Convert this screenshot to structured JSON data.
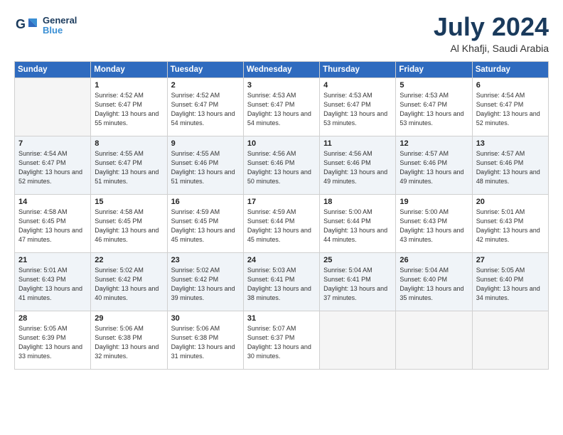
{
  "header": {
    "logo_line1": "General",
    "logo_line2": "Blue",
    "month": "July 2024",
    "location": "Al Khafji, Saudi Arabia"
  },
  "weekdays": [
    "Sunday",
    "Monday",
    "Tuesday",
    "Wednesday",
    "Thursday",
    "Friday",
    "Saturday"
  ],
  "weeks": [
    [
      {
        "day": "",
        "empty": true
      },
      {
        "day": "1",
        "sunrise": "4:52 AM",
        "sunset": "6:47 PM",
        "daylight": "13 hours and 55 minutes."
      },
      {
        "day": "2",
        "sunrise": "4:52 AM",
        "sunset": "6:47 PM",
        "daylight": "13 hours and 54 minutes."
      },
      {
        "day": "3",
        "sunrise": "4:53 AM",
        "sunset": "6:47 PM",
        "daylight": "13 hours and 54 minutes."
      },
      {
        "day": "4",
        "sunrise": "4:53 AM",
        "sunset": "6:47 PM",
        "daylight": "13 hours and 53 minutes."
      },
      {
        "day": "5",
        "sunrise": "4:53 AM",
        "sunset": "6:47 PM",
        "daylight": "13 hours and 53 minutes."
      },
      {
        "day": "6",
        "sunrise": "4:54 AM",
        "sunset": "6:47 PM",
        "daylight": "13 hours and 52 minutes."
      }
    ],
    [
      {
        "day": "7",
        "sunrise": "4:54 AM",
        "sunset": "6:47 PM",
        "daylight": "13 hours and 52 minutes."
      },
      {
        "day": "8",
        "sunrise": "4:55 AM",
        "sunset": "6:47 PM",
        "daylight": "13 hours and 51 minutes."
      },
      {
        "day": "9",
        "sunrise": "4:55 AM",
        "sunset": "6:46 PM",
        "daylight": "13 hours and 51 minutes."
      },
      {
        "day": "10",
        "sunrise": "4:56 AM",
        "sunset": "6:46 PM",
        "daylight": "13 hours and 50 minutes."
      },
      {
        "day": "11",
        "sunrise": "4:56 AM",
        "sunset": "6:46 PM",
        "daylight": "13 hours and 49 minutes."
      },
      {
        "day": "12",
        "sunrise": "4:57 AM",
        "sunset": "6:46 PM",
        "daylight": "13 hours and 49 minutes."
      },
      {
        "day": "13",
        "sunrise": "4:57 AM",
        "sunset": "6:46 PM",
        "daylight": "13 hours and 48 minutes."
      }
    ],
    [
      {
        "day": "14",
        "sunrise": "4:58 AM",
        "sunset": "6:45 PM",
        "daylight": "13 hours and 47 minutes."
      },
      {
        "day": "15",
        "sunrise": "4:58 AM",
        "sunset": "6:45 PM",
        "daylight": "13 hours and 46 minutes."
      },
      {
        "day": "16",
        "sunrise": "4:59 AM",
        "sunset": "6:45 PM",
        "daylight": "13 hours and 45 minutes."
      },
      {
        "day": "17",
        "sunrise": "4:59 AM",
        "sunset": "6:44 PM",
        "daylight": "13 hours and 45 minutes."
      },
      {
        "day": "18",
        "sunrise": "5:00 AM",
        "sunset": "6:44 PM",
        "daylight": "13 hours and 44 minutes."
      },
      {
        "day": "19",
        "sunrise": "5:00 AM",
        "sunset": "6:43 PM",
        "daylight": "13 hours and 43 minutes."
      },
      {
        "day": "20",
        "sunrise": "5:01 AM",
        "sunset": "6:43 PM",
        "daylight": "13 hours and 42 minutes."
      }
    ],
    [
      {
        "day": "21",
        "sunrise": "5:01 AM",
        "sunset": "6:43 PM",
        "daylight": "13 hours and 41 minutes."
      },
      {
        "day": "22",
        "sunrise": "5:02 AM",
        "sunset": "6:42 PM",
        "daylight": "13 hours and 40 minutes."
      },
      {
        "day": "23",
        "sunrise": "5:02 AM",
        "sunset": "6:42 PM",
        "daylight": "13 hours and 39 minutes."
      },
      {
        "day": "24",
        "sunrise": "5:03 AM",
        "sunset": "6:41 PM",
        "daylight": "13 hours and 38 minutes."
      },
      {
        "day": "25",
        "sunrise": "5:04 AM",
        "sunset": "6:41 PM",
        "daylight": "13 hours and 37 minutes."
      },
      {
        "day": "26",
        "sunrise": "5:04 AM",
        "sunset": "6:40 PM",
        "daylight": "13 hours and 35 minutes."
      },
      {
        "day": "27",
        "sunrise": "5:05 AM",
        "sunset": "6:40 PM",
        "daylight": "13 hours and 34 minutes."
      }
    ],
    [
      {
        "day": "28",
        "sunrise": "5:05 AM",
        "sunset": "6:39 PM",
        "daylight": "13 hours and 33 minutes."
      },
      {
        "day": "29",
        "sunrise": "5:06 AM",
        "sunset": "6:38 PM",
        "daylight": "13 hours and 32 minutes."
      },
      {
        "day": "30",
        "sunrise": "5:06 AM",
        "sunset": "6:38 PM",
        "daylight": "13 hours and 31 minutes."
      },
      {
        "day": "31",
        "sunrise": "5:07 AM",
        "sunset": "6:37 PM",
        "daylight": "13 hours and 30 minutes."
      },
      {
        "day": "",
        "empty": true
      },
      {
        "day": "",
        "empty": true
      },
      {
        "day": "",
        "empty": true
      }
    ]
  ]
}
